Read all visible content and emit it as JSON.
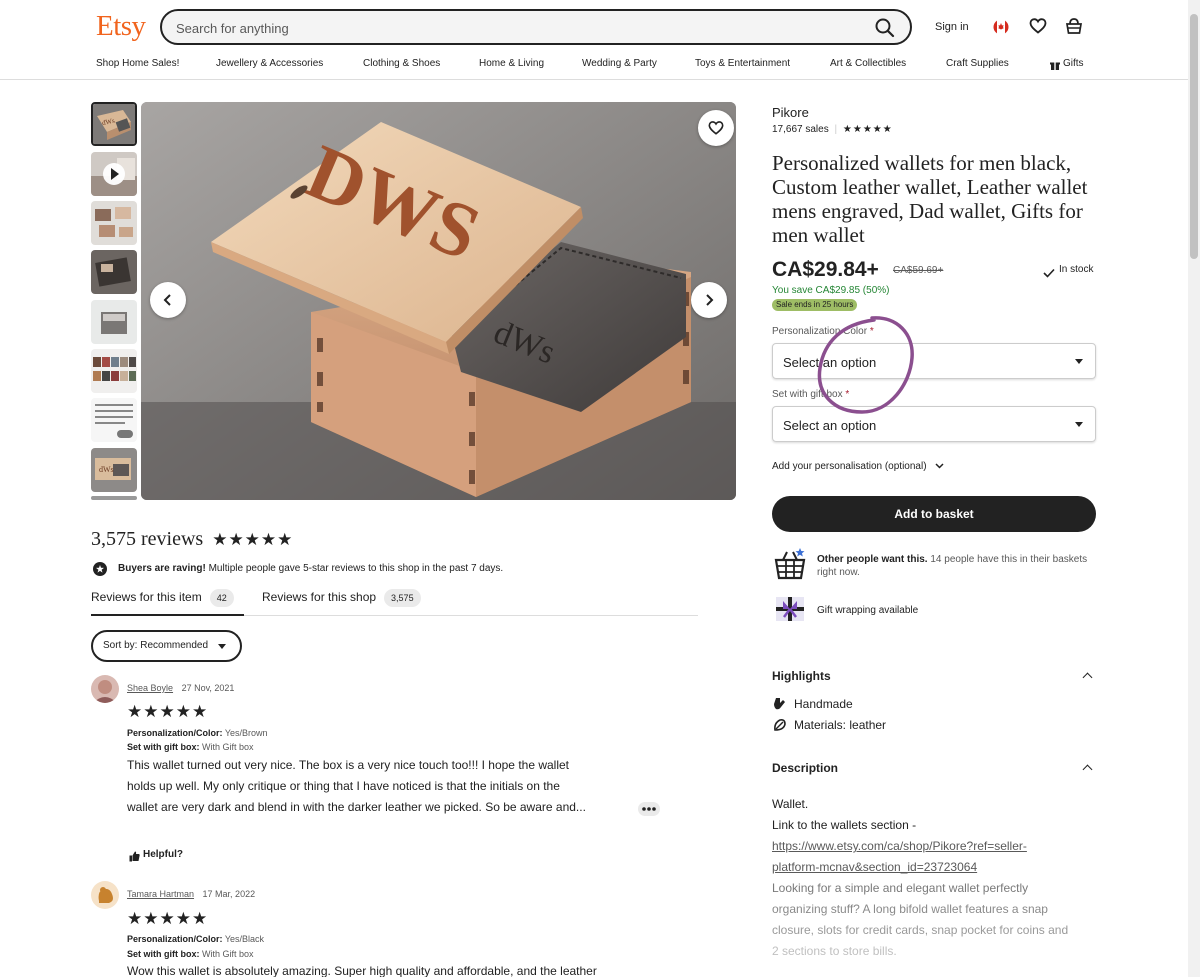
{
  "header": {
    "logo": "Etsy",
    "search_placeholder": "Search for anything",
    "sign_in": "Sign in",
    "nav": [
      "Shop Home Sales!",
      "Jewellery & Accessories",
      "Clothing & Shoes",
      "Home & Living",
      "Wedding & Party",
      "Toys & Entertainment",
      "Art & Collectibles",
      "Craft Supplies",
      "Gifts"
    ]
  },
  "listing": {
    "shop_name": "Pikore",
    "sales": "17,667 sales",
    "title": "Personalized wallets for men black, Custom leather wallet, Leather wallet mens engraved, Dad wallet, Gifts for men wallet",
    "price": "CA$29.84+",
    "old_price": "CA$59.69+",
    "stock": "In stock",
    "savings": "You save CA$29.85 (50%)",
    "sale_badge": "Sale ends in 25 hours",
    "field1_label": "Personalization Color",
    "field1_value": "Select an option",
    "field2_label": "Set with gift box",
    "field2_value": "Select an option",
    "personalisation": "Add your personalisation (optional)",
    "add_to_basket": "Add to basket",
    "others_bold": "Other people want this.",
    "others_rest": " 14 people have this in their baskets right now.",
    "gift_wrap": "Gift wrapping available",
    "engraving_big": "DWS",
    "engraving_small": "dWs"
  },
  "highlights": {
    "title": "Highlights",
    "items": [
      "Handmade",
      "Materials: leather"
    ]
  },
  "description": {
    "title": "Description",
    "line1": "Wallet.",
    "line2": "Link to the wallets section -",
    "link1": "https://www.etsy.com/ca/shop/Pikore?ref=seller-",
    "link2": "platform-mcnav&section_id=23723064",
    "line3": "Looking for a simple and elegant wallet perfectly",
    "line4": "organizing stuff? A long bifold wallet features a snap",
    "line5": "closure, slots for credit cards, snap pocket for coins and",
    "line6": "2 sections to store bills."
  },
  "reviews": {
    "count": "3,575 reviews",
    "stars": "★★★★★",
    "raving_bold": "Buyers are raving!",
    "raving_rest": " Multiple people gave 5-star reviews to this shop in the past 7 days.",
    "tab_item": "Reviews for this item",
    "tab_item_count": "42",
    "tab_shop": "Reviews for this shop",
    "tab_shop_count": "3,575",
    "sort": "Sort by: Recommended",
    "list": [
      {
        "name": "Shea Boyle",
        "date": "27 Nov, 2021",
        "stars": "★★★★★",
        "opt1_label": "Personalization/Color:",
        "opt1_value": " Yes/Brown",
        "opt2_label": "Set with gift box:",
        "opt2_value": " With Gift box",
        "line1": "This wallet turned out very nice. The box is a very nice touch too!!! I hope the wallet",
        "line2": "holds up well. My only critique or thing that I have noticed is that the initials on the",
        "line3": "wallet are very dark and blend in with the darker leather we picked. So be aware and...",
        "helpful": "Helpful?"
      },
      {
        "name": "Tamara Hartman",
        "date": "17 Mar, 2022",
        "stars": "★★★★★",
        "opt1_label": "Personalization/Color:",
        "opt1_value": " Yes/Black",
        "opt2_label": "Set with gift box:",
        "opt2_value": " With Gift box",
        "line1": "Wow this wallet is absolutely amazing. Super high quality and affordable, and the leather"
      }
    ]
  },
  "colors": {
    "brand": "#f1641e",
    "green": "#258635",
    "sale_badge": "#9ebd65",
    "annotation": "#8b4f8f"
  }
}
